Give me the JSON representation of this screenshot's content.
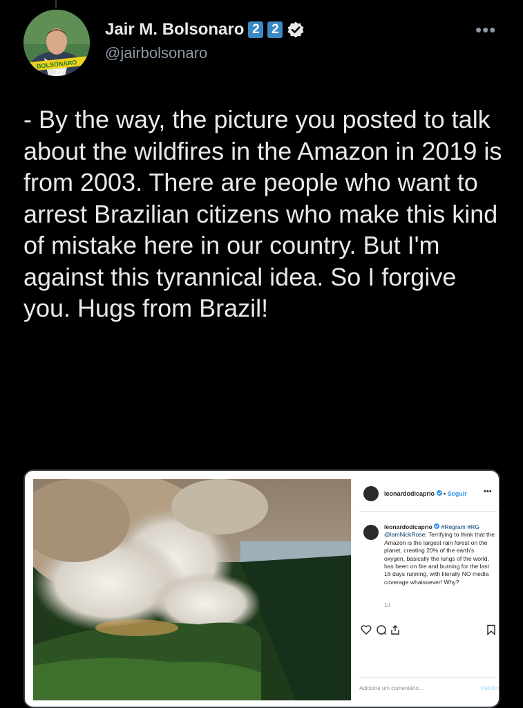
{
  "author": {
    "display_name": "Jair M. Bolsonaro",
    "badges": [
      "2",
      "2"
    ],
    "handle": "@jairbolsonaro",
    "avatar_logo_text": "BOLSONARO",
    "avatar_logo_number": "22"
  },
  "tweet": {
    "text": "- By the way, the picture you posted to talk about the wildfires in the Amazon in 2019 is from 2003. There are people who want to arrest Brazilian citizens who make this kind of mistake here in our country. But I'm against this tyrannical idea. So I forgive you. Hugs from Brazil!"
  },
  "embedded_post": {
    "username": "leonardodicaprio",
    "separator": "•",
    "follow_label": "Seguir",
    "more": "•••",
    "caption_user": "leonardodicaprio",
    "caption_tags": "#Regram #RG",
    "caption_mention": "@lamNickRose:",
    "caption_body": "Terrifying to think that the Amazon is the largest rain forest on the planet, creating 20% of the earth's oxygen, basically the lungs of the world, has been on fire and burning for the last 16 days running, with literally NO media coverage whatsoever! Why?",
    "age": "1d",
    "comment_placeholder": "Adicione um comentário...",
    "publish_label": "Publicar"
  },
  "colors": {
    "background": "#000000",
    "text": "#e7e9ea",
    "secondary": "#8b98a5",
    "badge_blue": "#3b88c3"
  }
}
